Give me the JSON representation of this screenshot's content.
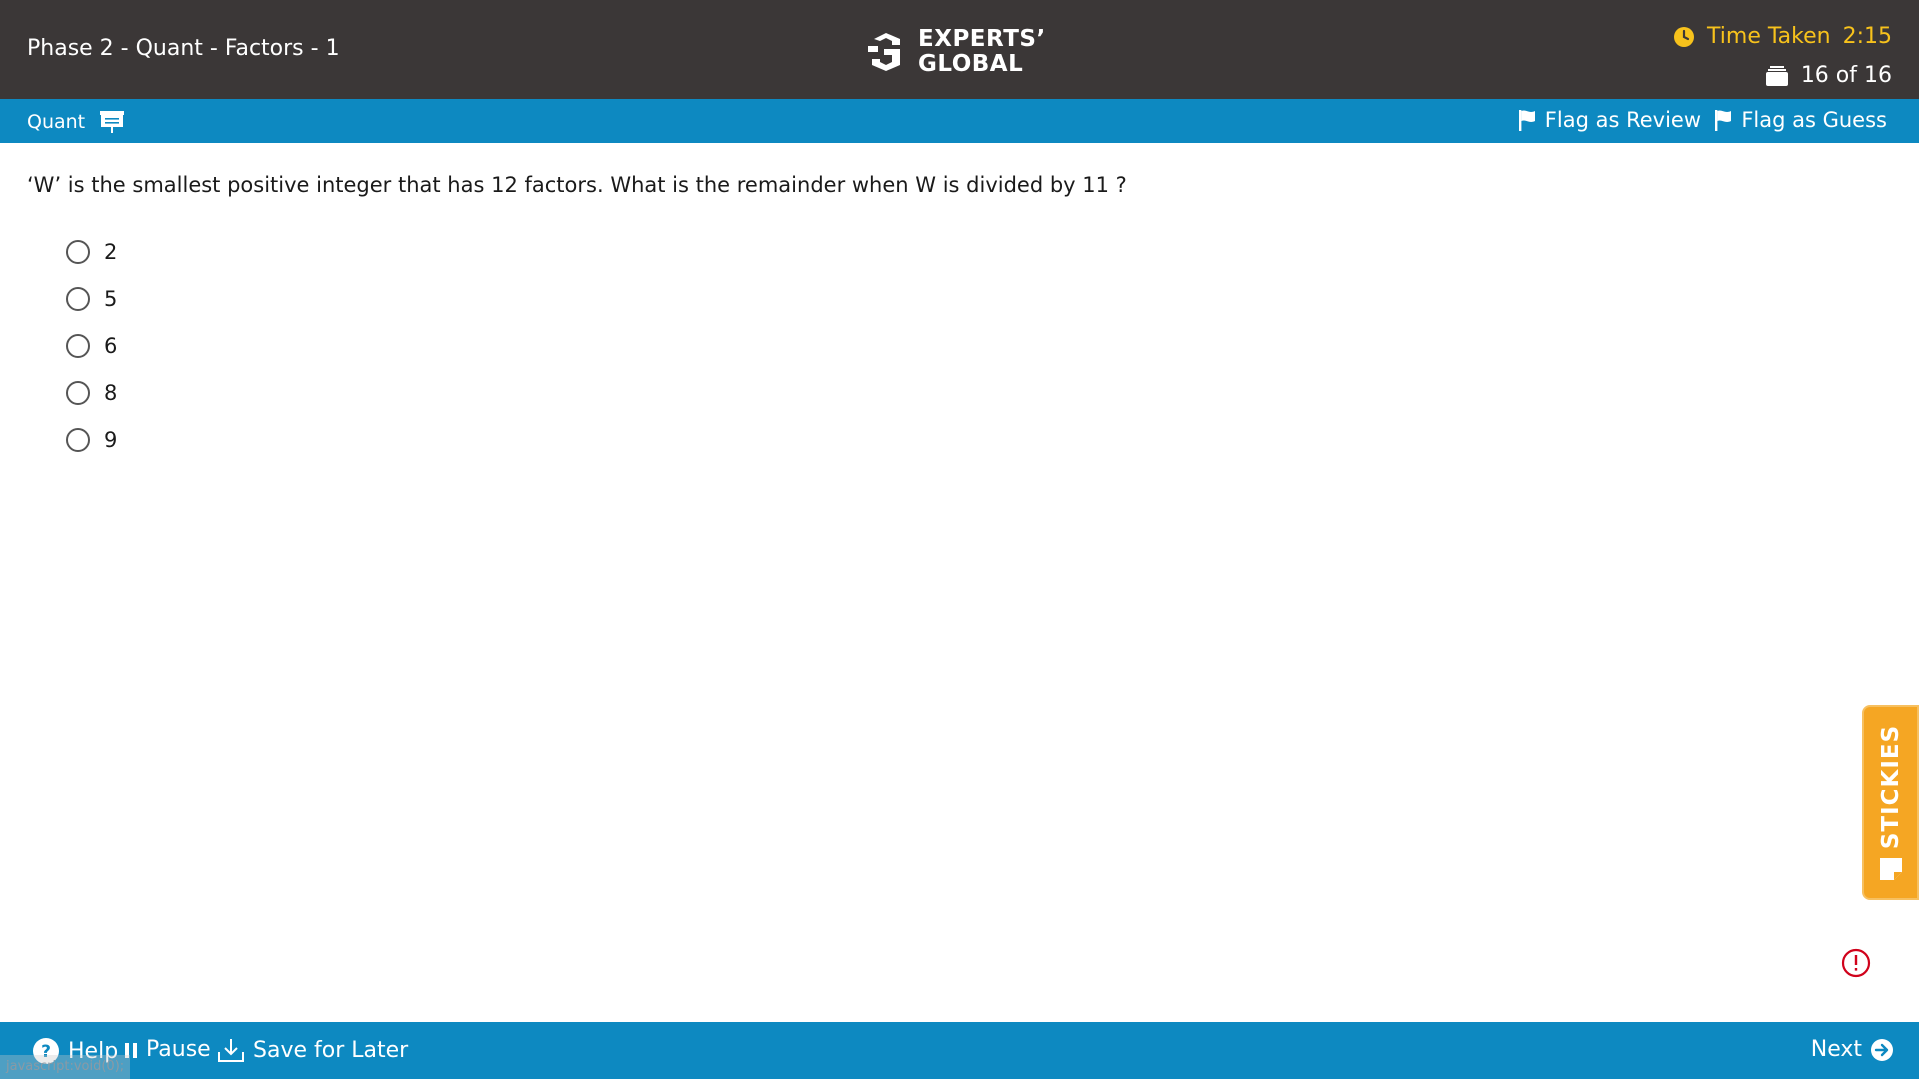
{
  "header": {
    "test_title": "Phase 2 - Quant - Factors - 1",
    "logo_line1": "EXPERTS’",
    "logo_line2": "GLOBAL",
    "timer_label": "Time Taken",
    "timer_value": "2:15",
    "question_count": "16 of 16"
  },
  "section_bar": {
    "section_name": "Quant",
    "flag_review_label": "Flag as Review",
    "flag_guess_label": "Flag as Guess"
  },
  "question": {
    "text": "‘W’ is the smallest positive integer that has 12 factors. What is the remainder when W is divided by 11 ?",
    "options": [
      {
        "label": "2"
      },
      {
        "label": "5"
      },
      {
        "label": "6"
      },
      {
        "label": "8"
      },
      {
        "label": "9"
      }
    ]
  },
  "stickies": {
    "label": "STICKIES"
  },
  "footer": {
    "help_label": "Help",
    "pause_label": "Pause",
    "save_label": "Save for Later",
    "next_label": "Next",
    "status_url": "javascript:void(0);"
  },
  "colors": {
    "header_bg": "#3b3737",
    "accent_blue": "#0d89c1",
    "timer_yellow": "#f7c21c",
    "stickies_orange": "#f5a623",
    "alert_red": "#d0021b"
  }
}
